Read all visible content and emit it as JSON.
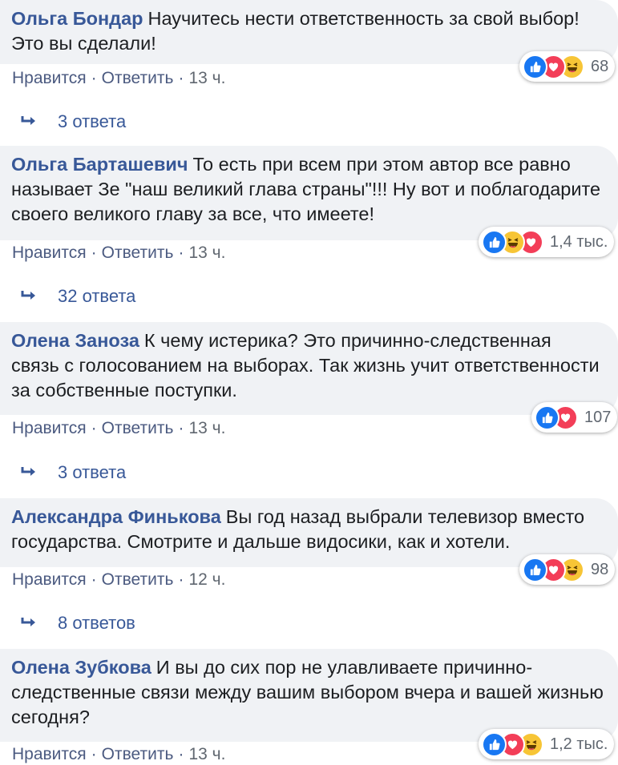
{
  "comments": [
    {
      "author": "Ольга Бондар",
      "text": "Научитесь нести ответственность за свой выбор! Это вы сделали!",
      "like_label": "Нравится",
      "reply_label": "Ответить",
      "time": "13 ч.",
      "reaction_count": "68",
      "reactions": [
        "like-icon",
        "love-icon",
        "haha-icon"
      ],
      "replies_label": "3 ответа"
    },
    {
      "author": "Ольга Барташевич",
      "text": "То есть при всем при этом автор все равно называет Зе \"наш великий глава страны\"!!! Ну вот и поблагодарите своего великого главу за все, что имеете!",
      "like_label": "Нравится",
      "reply_label": "Ответить",
      "time": "13 ч.",
      "reaction_count": "1,4 тыс.",
      "reactions": [
        "like-icon",
        "haha-icon",
        "love-icon"
      ],
      "replies_label": "32 ответа"
    },
    {
      "author": "Олена Заноза",
      "text": "К чему истерика? Это причинно-следственная связь с голосованием на выборах. Так жизнь учит ответственности за собственные поступки.",
      "like_label": "Нравится",
      "reply_label": "Ответить",
      "time": "13 ч.",
      "reaction_count": "107",
      "reactions": [
        "like-icon",
        "love-icon"
      ],
      "replies_label": "3 ответа"
    },
    {
      "author": "Александра Финькова",
      "text": "Вы год назад выбрали телевизор вместо государства. Смотрите и дальше видосики, как и хотели.",
      "like_label": "Нравится",
      "reply_label": "Ответить",
      "time": "12 ч.",
      "reaction_count": "98",
      "reactions": [
        "like-icon",
        "love-icon",
        "haha-icon"
      ],
      "replies_label": "8 ответов"
    },
    {
      "author": "Олена Зубкова",
      "text": "И вы до сих пор не улавливаете причинно-следственные связи между вашим выбором вчера и вашей жизнью сегодня?",
      "like_label": "Нравится",
      "reply_label": "Ответить",
      "time": "13 ч.",
      "reaction_count": "1,2 тыс.",
      "reactions": [
        "like-icon",
        "love-icon",
        "haha-icon"
      ],
      "replies_label": null
    }
  ],
  "colors": {
    "bubble": "#f0f2f5",
    "author": "#385898",
    "like": "#1877f2",
    "love": "#f33e58",
    "haha": "#f7c536"
  }
}
